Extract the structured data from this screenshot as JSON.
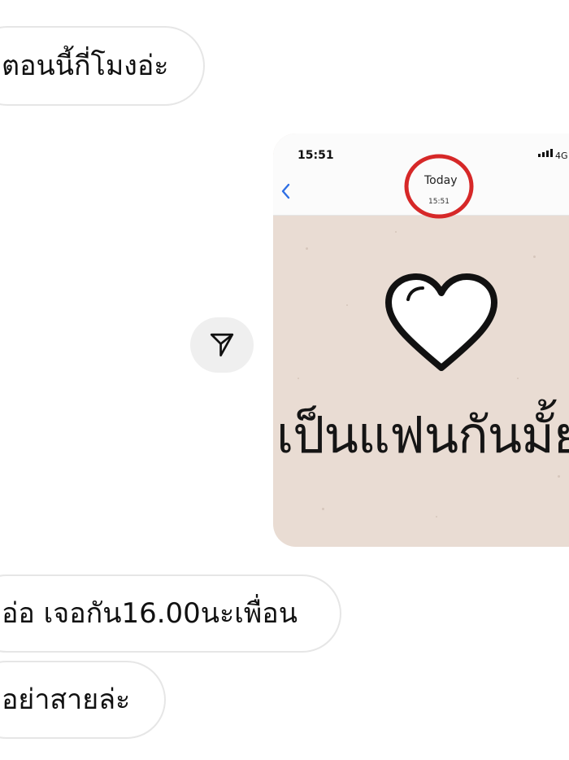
{
  "messages": [
    {
      "text": "ตอนนี้กี่โมงอ่ะ"
    },
    {
      "text": "อ่อ เจอกัน16.00นะเพื่อน"
    },
    {
      "text": "อย่าสายล่ะ"
    }
  ],
  "shared_image": {
    "status_time": "15:51",
    "network": "4G",
    "header_title": "Today",
    "header_time": "15:51",
    "big_text": "เป็นแฟนกันมั้ย",
    "background_color": "#e9dcd3",
    "highlight_color": "#d62828"
  },
  "icons": {
    "share": "paper-plane-icon",
    "back": "chevron-left-icon",
    "heart": "heart-icon"
  }
}
